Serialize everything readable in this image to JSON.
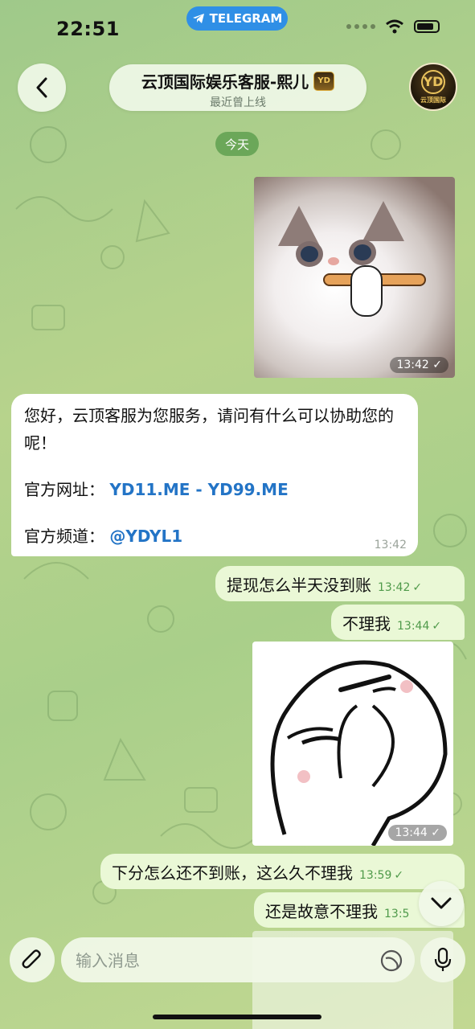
{
  "status_bar": {
    "time": "22:51",
    "app_pill": "TELEGRAM"
  },
  "header": {
    "title": "云顶国际娱乐客服-熙儿",
    "title_badge": "YD",
    "status": "最近曾上线",
    "avatar_text": "云顶国际",
    "avatar_mono": "YD"
  },
  "date_chip": "今天",
  "messages": [
    {
      "type": "photo",
      "direction": "out",
      "time": "13:42",
      "status": "read"
    },
    {
      "type": "text",
      "direction": "in",
      "greeting": "您好，云顶客服为您服务，请问有什么可以协助您的呢！",
      "site_label": "官方网址：",
      "site_link_1": "YD11.ME",
      "site_sep": " - ",
      "site_link_2": "YD99.ME",
      "channel_label": "官方频道：",
      "channel_link": "@YDYL1",
      "time": "13:42"
    },
    {
      "type": "text",
      "direction": "out",
      "text": "提现怎么半天没到账",
      "time": "13:42"
    },
    {
      "type": "text",
      "direction": "out",
      "text": "不理我",
      "time": "13:44"
    },
    {
      "type": "photo",
      "direction": "out",
      "time": "13:44",
      "status": "read"
    },
    {
      "type": "text",
      "direction": "out",
      "text": "下分怎么还不到账，这么久不理我",
      "time": "13:59"
    },
    {
      "type": "text",
      "direction": "out",
      "text": "还是故意不理我",
      "time": "13:5"
    }
  ],
  "composer": {
    "placeholder": "输入消息"
  },
  "colors": {
    "accent": "#2f8fe6",
    "link": "#2374c6",
    "outgoing_bubble": "#eaf8d6",
    "incoming_bubble": "#ffffff"
  }
}
